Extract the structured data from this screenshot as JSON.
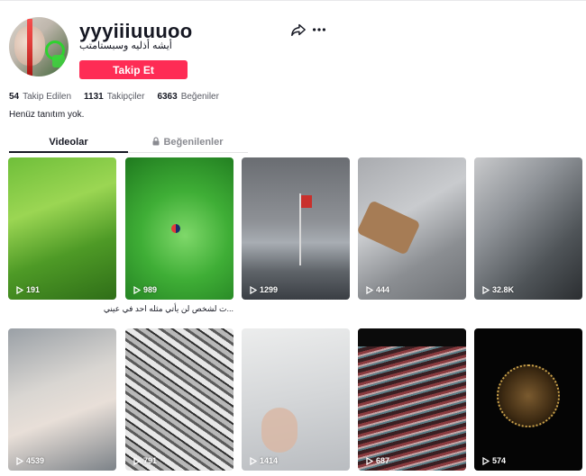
{
  "profile": {
    "username": "yyyiiiuuuoo",
    "nickname": "أيشه أذليه وسبستامتب",
    "follow_label": "Takip Et",
    "bio": "Henüz tanıtım yok."
  },
  "stats": [
    {
      "value": "54",
      "label": "Takip Edilen"
    },
    {
      "value": "1131",
      "label": "Takipçiler"
    },
    {
      "value": "6363",
      "label": "Beğeniler"
    }
  ],
  "tabs": {
    "videos": "Videolar",
    "liked": "Beğenilenler"
  },
  "videos": [
    {
      "views": "191"
    },
    {
      "views": "989",
      "caption": "...ت لشخص لن يأتي مثله احد في عيني"
    },
    {
      "views": "1299"
    },
    {
      "views": "444"
    },
    {
      "views": "32.8K"
    },
    {
      "views": "4539"
    },
    {
      "views": "791"
    },
    {
      "views": "1414"
    },
    {
      "views": "687"
    },
    {
      "views": "574"
    }
  ],
  "colors": {
    "accent": "#fe2c55",
    "text": "#161823",
    "muted": "#8a8b91"
  }
}
